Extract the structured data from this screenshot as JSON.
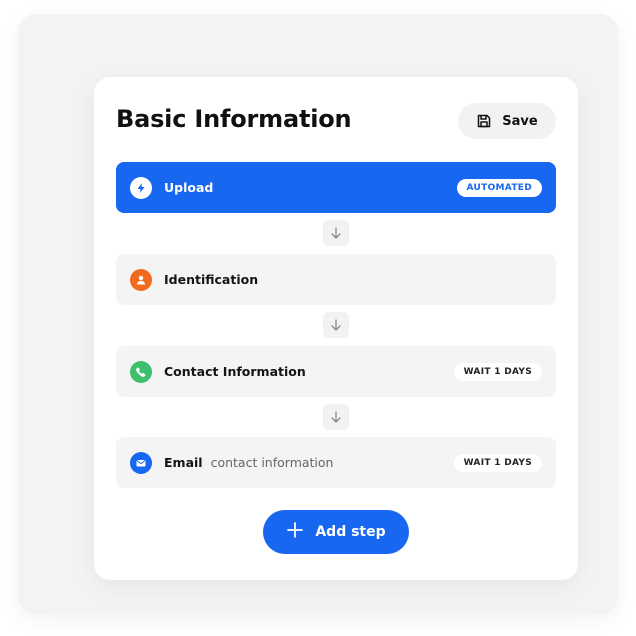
{
  "header": {
    "title": "Basic Information",
    "save_label": "Save"
  },
  "steps": [
    {
      "name": "Upload",
      "sub": "",
      "badge": "AUTOMATED",
      "icon": "lightning-icon",
      "icon_color": "#ffffff",
      "active": true
    },
    {
      "name": "Identification",
      "sub": "",
      "badge": "",
      "icon": "person-icon",
      "icon_color": "#f26a1b",
      "active": false
    },
    {
      "name": "Contact Information",
      "sub": "",
      "badge": "WAIT 1 DAYS",
      "icon": "phone-icon",
      "icon_color": "#3dbf6e",
      "active": false
    },
    {
      "name": "Email",
      "sub": "contact information",
      "badge": "WAIT 1 DAYS",
      "icon": "mail-icon",
      "icon_color": "#1867f0",
      "active": false
    }
  ],
  "footer": {
    "add_label": "Add step"
  },
  "colors": {
    "accent": "#1867f0",
    "step_bg": "#f4f4f4",
    "card_bg": "#ffffff"
  }
}
